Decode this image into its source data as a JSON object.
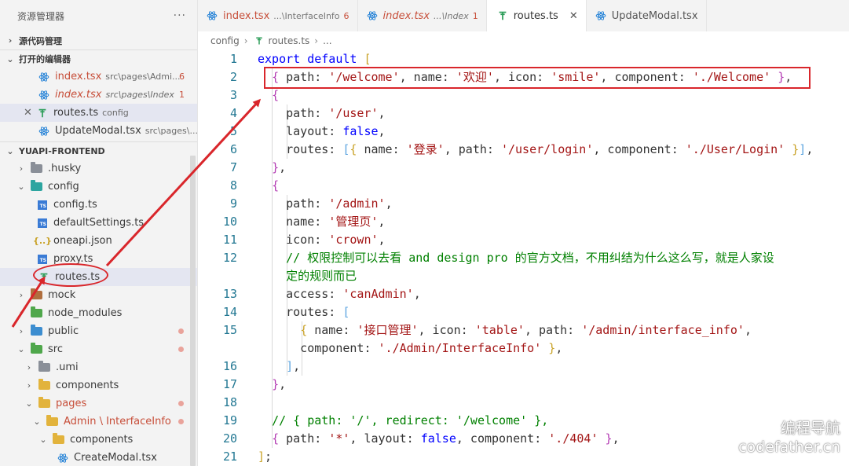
{
  "sidebar": {
    "title": "资源管理器",
    "more": "···",
    "source_control": "源代码管理",
    "open_editors": {
      "title": "打开的编辑器",
      "items": [
        {
          "name": "index.tsx",
          "desc": "src\\pages\\Admi...",
          "badge": "6"
        },
        {
          "name": "index.tsx",
          "desc": "src\\pages\\Index",
          "badge": "1"
        },
        {
          "name": "routes.ts",
          "desc": "config",
          "badge": ""
        },
        {
          "name": "UpdateModal.tsx",
          "desc": "src\\pages\\...",
          "badge": ""
        }
      ]
    },
    "project": {
      "title": "YUAPI-FRONTEND",
      "items": [
        {
          "name": ".husky",
          "chev": "›"
        },
        {
          "name": "config",
          "chev": "⌄"
        },
        {
          "name": "config.ts"
        },
        {
          "name": "defaultSettings.ts"
        },
        {
          "name": "oneapi.json",
          "icon": "{..}"
        },
        {
          "name": "proxy.ts"
        },
        {
          "name": "routes.ts"
        },
        {
          "name": "mock",
          "chev": "›"
        },
        {
          "name": "node_modules",
          "chev": "›"
        },
        {
          "name": "public",
          "chev": "›"
        },
        {
          "name": "src",
          "chev": "⌄"
        },
        {
          "name": ".umi",
          "chev": "›"
        },
        {
          "name": "components",
          "chev": "›"
        },
        {
          "name": "pages",
          "chev": "⌄"
        },
        {
          "name": "Admin \\ InterfaceInfo",
          "chev": "⌄"
        },
        {
          "name": "components",
          "chev": "⌄"
        },
        {
          "name": "CreateModal.tsx"
        }
      ]
    }
  },
  "tabs": [
    {
      "name": "index.tsx",
      "desc": "...\\InterfaceInfo",
      "badge": "6"
    },
    {
      "name": "index.tsx",
      "desc": "...\\Index",
      "badge": "1"
    },
    {
      "name": "routes.ts",
      "close": "✕"
    },
    {
      "name": "UpdateModal.tsx"
    }
  ],
  "breadcrumb": {
    "folder": "config",
    "file": "routes.ts",
    "rest": "...",
    "sep": "›"
  },
  "editor": {
    "line_numbers": [
      "1",
      "2",
      "3",
      "4",
      "5",
      "6",
      "7",
      "8",
      "9",
      "10",
      "11",
      "12",
      "13",
      "14",
      "15",
      "16",
      "17",
      "18",
      "19",
      "20",
      "21"
    ],
    "comment_line12": "// 权限控制可以去看 and design pro 的官方文档，不用纠结为什么这么写，就是人家设",
    "comment_line12_wrap": "定的规则而已"
  },
  "watermark": {
    "line1": "编程导航",
    "line2": "codefather.cn"
  },
  "colors": {
    "keyword": "#0000ff",
    "string": "#a31515",
    "comment": "#008000",
    "line_number": "#237893",
    "annotation": "#d9262b",
    "error": "#c74e39"
  }
}
